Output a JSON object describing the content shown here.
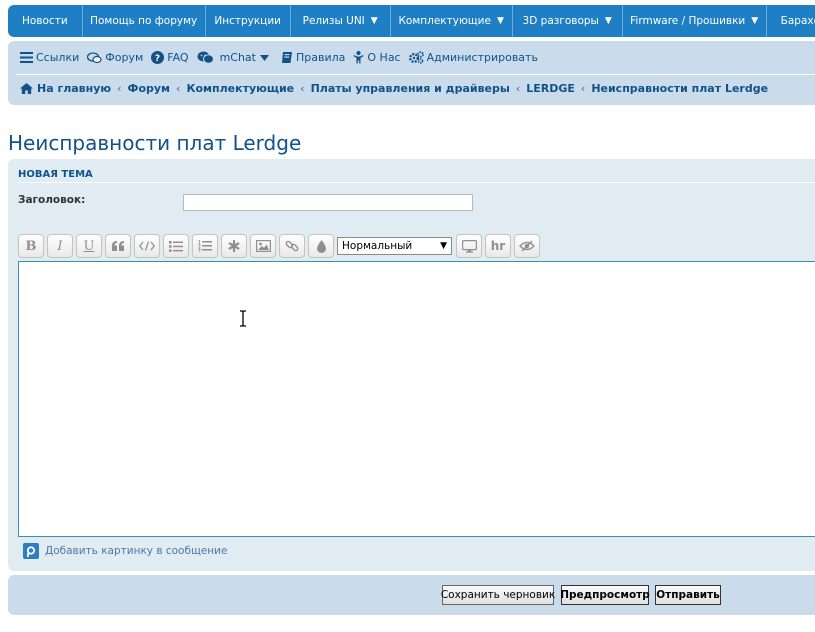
{
  "topnav": {
    "items": [
      {
        "label": "Новости",
        "dropdown": false
      },
      {
        "label": "Помощь по форуму",
        "dropdown": false
      },
      {
        "label": "Инструкции",
        "dropdown": false
      },
      {
        "label": "Релизы UNI",
        "dropdown": true
      },
      {
        "label": "Комплектующие",
        "dropdown": true
      },
      {
        "label": "3D разговоры",
        "dropdown": true
      },
      {
        "label": "Firmware / Прошивки",
        "dropdown": true
      },
      {
        "label": "Барахо",
        "dropdown": false
      }
    ],
    "caret": "▼"
  },
  "quicklinks": {
    "links": "Ссылки",
    "forum": "Форум",
    "faq": "FAQ",
    "mchat": "mChat",
    "rules": "Правила",
    "about": "О Нас",
    "admin": "Администрировать"
  },
  "breadcrumb": {
    "home": "На главную",
    "items": [
      "Форум",
      "Комплектующие",
      "Платы управления и драйверы",
      "LERDGE",
      "Неисправности плат Lerdge"
    ],
    "separator": "‹"
  },
  "page": {
    "title": "Неисправности плат Lerdge"
  },
  "form": {
    "section": "НОВАЯ ТЕМА",
    "subject_label": "Заголовок:",
    "subject_value": "",
    "toolbar": {
      "bold": "B",
      "italic": "I",
      "underline": "U",
      "size_selected": "Нормальный",
      "hr": "hr"
    },
    "add_image": "Добавить картинку в сообщение"
  },
  "buttons": {
    "save_draft": "Сохранить черновик",
    "preview": "Предпросмотр",
    "submit": "Отправить"
  },
  "colors": {
    "topbar": "#1e7fc4",
    "panel": "#cadceb",
    "formpanel": "#e1ebf2",
    "link": "#105289"
  }
}
